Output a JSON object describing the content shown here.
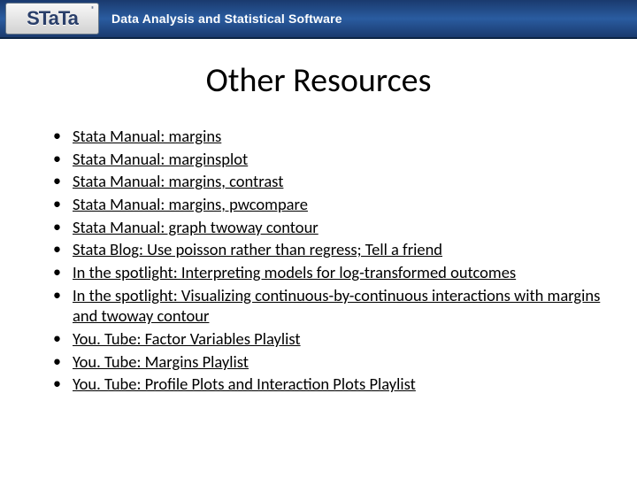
{
  "banner": {
    "logo_text": "STaTa",
    "tagline": "Data Analysis and Statistical Software"
  },
  "title": "Other Resources",
  "resources": [
    "Stata Manual: margins",
    "Stata Manual: marginsplot",
    "Stata Manual: margins, contrast",
    "Stata Manual: margins, pwcompare",
    "Stata Manual: graph twoway contour",
    "Stata Blog: Use poisson rather than regress; Tell a friend",
    "In the spotlight: Interpreting models for log-transformed outcomes",
    "In the spotlight: Visualizing continuous-by-continuous interactions with margins and twoway contour",
    "You. Tube: Factor Variables Playlist",
    "You. Tube: Margins Playlist",
    "You. Tube: Profile Plots and Interaction Plots Playlist"
  ]
}
